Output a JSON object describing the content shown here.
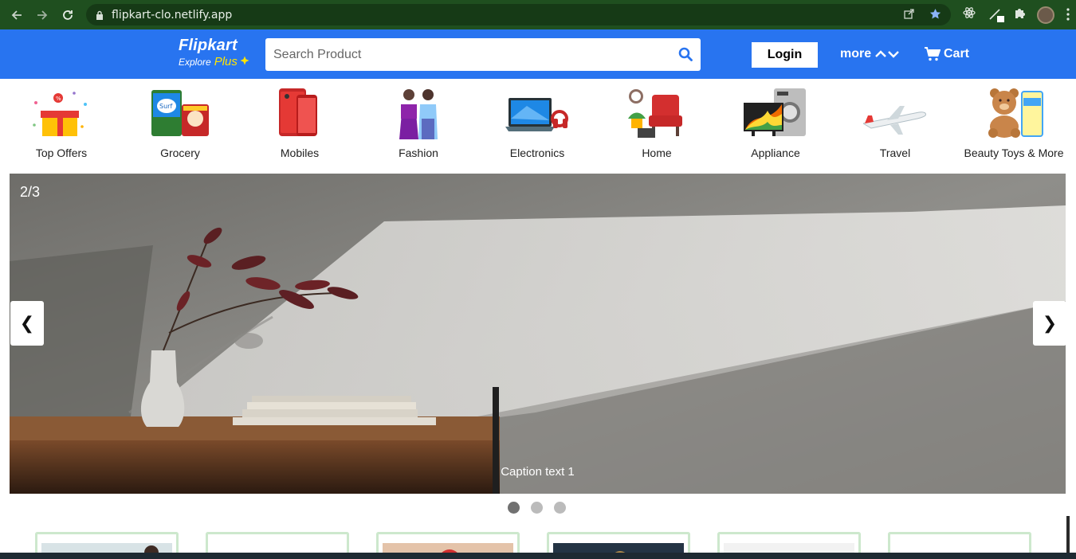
{
  "browser": {
    "url": "flipkart-clo.netlify.app",
    "back_icon": "arrow-left-icon",
    "forward_icon": "arrow-right-icon",
    "reload_icon": "reload-icon"
  },
  "header": {
    "logo_text": "Flipkart",
    "logo_explore": "Explore",
    "logo_plus": "Plus",
    "search_placeholder": "Search Product",
    "login_label": "Login",
    "more_label": "more",
    "cart_label": "Cart",
    "brand_color": "#2874f0",
    "plus_color": "#ffe500"
  },
  "categories": [
    {
      "label": "Top Offers",
      "icon": "gift-icon"
    },
    {
      "label": "Grocery",
      "icon": "grocery-icon"
    },
    {
      "label": "Mobiles",
      "icon": "mobile-icon"
    },
    {
      "label": "Fashion",
      "icon": "fashion-icon"
    },
    {
      "label": "Electronics",
      "icon": "laptop-icon"
    },
    {
      "label": "Home",
      "icon": "home-decor-icon"
    },
    {
      "label": "Appliance",
      "icon": "appliance-icon"
    },
    {
      "label": "Travel",
      "icon": "airplane-icon"
    },
    {
      "label": "Beauty Toys & More",
      "icon": "teddy-bear-icon"
    }
  ],
  "carousel": {
    "counter": "2/3",
    "caption": "Caption text 1",
    "prev_label": "❮",
    "next_label": "❯",
    "slide_count": 3,
    "active_index": 0
  }
}
